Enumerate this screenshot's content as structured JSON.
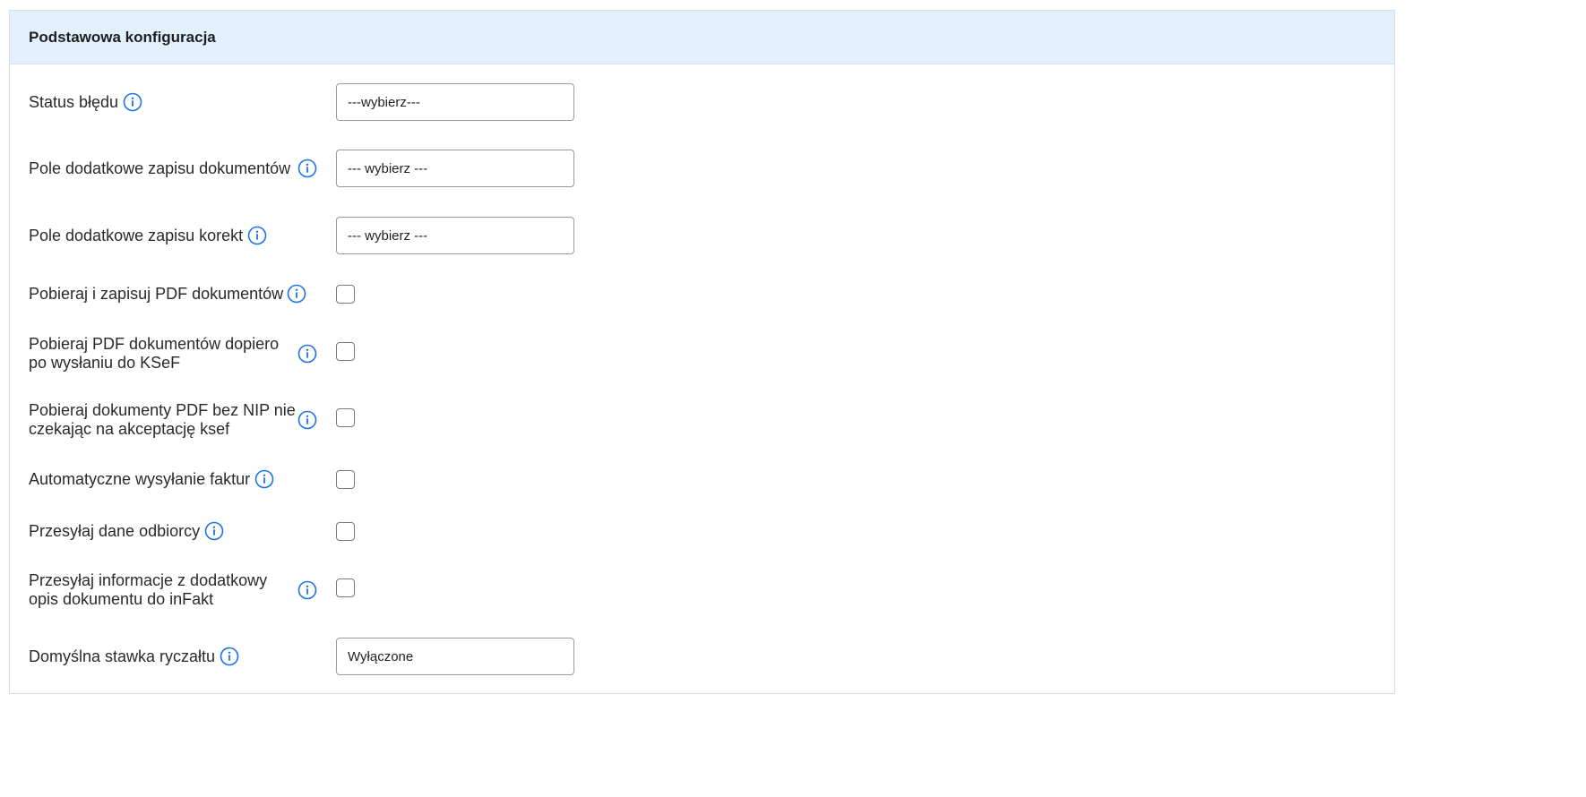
{
  "section": {
    "title": "Podstawowa konfiguracja"
  },
  "colors": {
    "header_bg": "#e3f0fd",
    "info_icon": "#1a73e8"
  },
  "fields": {
    "error_status": {
      "label": "Status błędu",
      "value": "---wybierz---",
      "icon": "info-icon"
    },
    "doc_extra_field": {
      "label": "Pole dodatkowe zapisu dokumentów",
      "value": "--- wybierz ---",
      "icon": "info-icon"
    },
    "correction_extra_field": {
      "label": "Pole dodatkowe zapisu korekt",
      "value": "--- wybierz ---",
      "icon": "info-icon"
    },
    "download_pdf": {
      "label": "Pobieraj i zapisuj PDF dokumentów",
      "checked": false,
      "icon": "info-icon"
    },
    "download_pdf_after_ksef": {
      "label": "Pobieraj PDF dokumentów dopiero po wysłaniu do KSeF",
      "checked": false,
      "icon": "info-icon"
    },
    "download_pdf_no_nip": {
      "label": "Pobieraj dokumenty PDF bez NIP nie czekając na akceptację ksef",
      "checked": false,
      "icon": "info-icon"
    },
    "auto_send_invoices": {
      "label": "Automatyczne wysyłanie faktur",
      "checked": false,
      "icon": "info-icon"
    },
    "send_recipient_data": {
      "label": "Przesyłaj dane odbiorcy",
      "checked": false,
      "icon": "info-icon"
    },
    "send_extra_description": {
      "label": "Przesyłaj informacje z dodatkowy opis dokumentu do inFakt",
      "checked": false,
      "icon": "info-icon"
    },
    "default_lump_rate": {
      "label": "Domyślna stawka ryczałtu",
      "value": "Wyłączone",
      "icon": "info-icon"
    }
  }
}
